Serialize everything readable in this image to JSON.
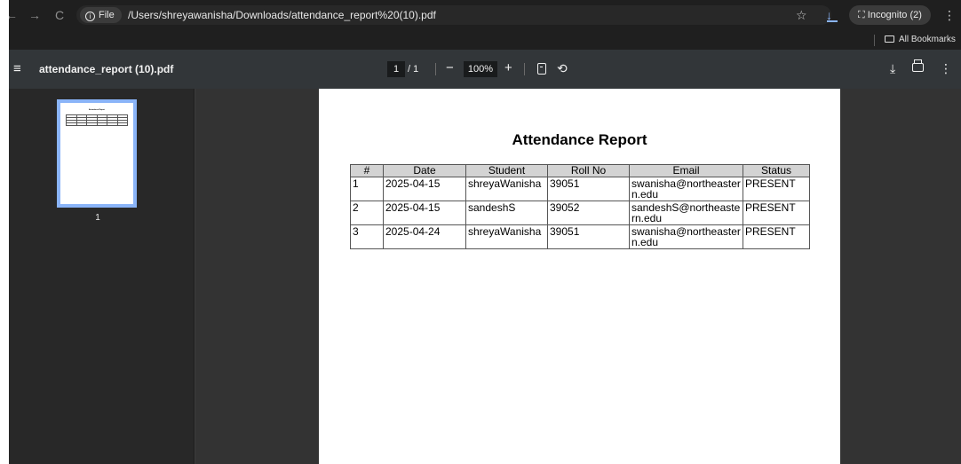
{
  "browser": {
    "nav_back": "←",
    "nav_forward": "→",
    "nav_reload": "C",
    "file_chip_label": "File",
    "url": "/Users/shreyawanisha/Downloads/attendance_report%20(10).pdf",
    "star_icon": "star-icon",
    "incognito_label": "Incognito (2)",
    "all_bookmarks_label": "All Bookmarks"
  },
  "pdf_toolbar": {
    "title": "attendance_report (10).pdf",
    "current_page": "1",
    "total_pages": "/ 1",
    "zoom": "100%",
    "zoom_out": "−",
    "zoom_in": "+"
  },
  "sidebar": {
    "thumbnail_label": "1",
    "thumbnail_title": "Attendance Report"
  },
  "document": {
    "title": "Attendance Report",
    "columns": [
      "#",
      "Date",
      "Student",
      "Roll No",
      "Email",
      "Status"
    ],
    "rows": [
      [
        "1",
        "2025-04-15",
        "shreyaWanisha",
        "39051",
        "swanisha@northeastern.edu",
        "PRESENT"
      ],
      [
        "2",
        "2025-04-15",
        "sandeshS",
        "39052",
        "sandeshS@northeastern.edu",
        "PRESENT"
      ],
      [
        "3",
        "2025-04-24",
        "shreyaWanisha",
        "39051",
        "swanisha@northeastern.edu",
        "PRESENT"
      ]
    ]
  },
  "colors": {
    "toolbar_bg": "#1f1f1f",
    "pdf_toolbar_bg": "#323639",
    "doc_bg": "#333333",
    "thumb_border": "#8ab4f8"
  }
}
